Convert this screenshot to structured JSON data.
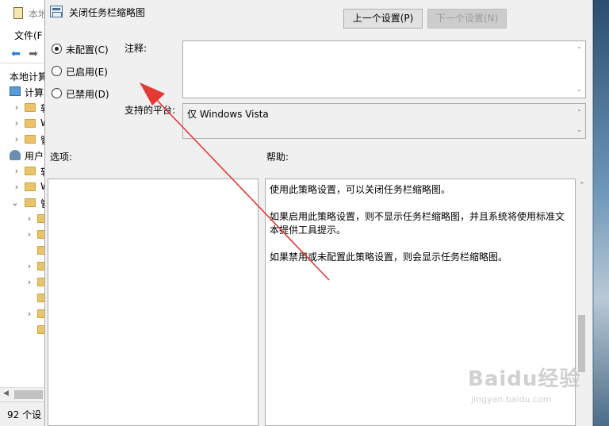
{
  "background_window": {
    "title": "本地",
    "menu_label": "文件(F",
    "tree_header": "本地计算",
    "tree_items": [
      {
        "label": "计算"
      },
      {
        "label": "软"
      },
      {
        "label": "W"
      },
      {
        "label": "管"
      },
      {
        "label": "用户"
      },
      {
        "label": "软"
      },
      {
        "label": "W"
      },
      {
        "label": "管"
      }
    ],
    "status_text": "92 个设"
  },
  "dialog": {
    "title": "关闭任务栏缩略图",
    "prev_button": "上一个设置(P)",
    "next_button": "下一个设置(N)",
    "radio_options": [
      {
        "label": "未配置(C)",
        "checked": true
      },
      {
        "label": "已启用(E)",
        "checked": false
      },
      {
        "label": "已禁用(D)",
        "checked": false
      }
    ],
    "comment_label": "注释:",
    "supported_label": "支持的平台:",
    "supported_value": "仅 Windows Vista",
    "options_label": "选项:",
    "help_label": "帮助:",
    "help_paragraphs": [
      "使用此策略设置，可以关闭任务栏缩略图。",
      "如果启用此策略设置，则不显示任务栏缩略图，并且系统将使用标准文本提供工具提示。",
      "如果禁用或未配置此策略设置，则会显示任务栏缩略图。"
    ]
  },
  "watermark": {
    "brand": "Baidu经验",
    "url": "jingyan.baidu.com"
  },
  "colors": {
    "annotation_arrow": "#e53935",
    "accent_blue": "#2d7dd2"
  },
  "icons": [
    "policy-icon",
    "back-arrow-icon",
    "forward-arrow-icon",
    "folder-icon",
    "computer-icon",
    "user-icon",
    "document-icon"
  ]
}
